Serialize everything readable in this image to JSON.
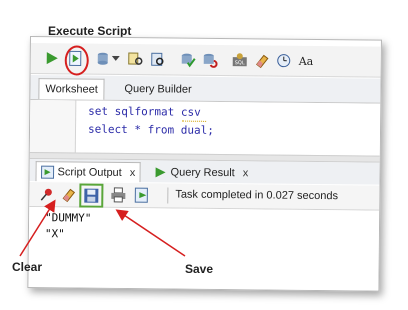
{
  "annotations": {
    "execute_script": "Execute Script",
    "clear": "Clear",
    "save": "Save"
  },
  "worksheet_tabs": [
    {
      "label": "Worksheet"
    },
    {
      "label": "Query Builder"
    }
  ],
  "editor": {
    "lines": [
      "set sqlformat csv",
      "select * from dual;"
    ]
  },
  "output_tabs": [
    {
      "label": "Script Output",
      "close": "x"
    },
    {
      "label": "Query Result",
      "close": "x"
    }
  ],
  "status": "Task completed in 0.027 seconds",
  "output_lines": [
    "\"DUMMY\"",
    "\"X\""
  ],
  "colors": {
    "highlight_red": "#d61f1f",
    "highlight_green": "#5aa63a",
    "arrow_red": "#d61f1f",
    "code_blue": "#2b2ba8"
  },
  "icons": [
    "run-statement-icon",
    "run-script-icon",
    "commit-icon",
    "rollback-icon",
    "explain-plan-icon",
    "autotrace-icon",
    "sql-tuning-icon",
    "eraser-icon",
    "history-icon",
    "format-icon",
    "pin-icon",
    "save-icon",
    "print-icon",
    "export-icon"
  ]
}
